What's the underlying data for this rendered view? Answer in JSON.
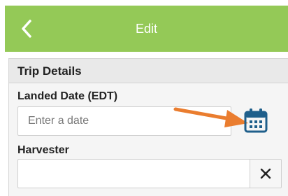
{
  "header": {
    "back_icon": "chevron-left-icon",
    "title": "Edit",
    "color": "#94c957"
  },
  "section": {
    "title": "Trip Details"
  },
  "fields": {
    "landed_date": {
      "label": "Landed Date (EDT)",
      "placeholder": "Enter a date",
      "value": "",
      "picker_icon": "calendar-icon",
      "picker_color": "#1f5f8b"
    },
    "harvester": {
      "label": "Harvester",
      "value": "",
      "clear_icon": "close-icon"
    }
  },
  "annotation": {
    "icon": "arrow-right-icon",
    "color": "#ea7d2f"
  }
}
